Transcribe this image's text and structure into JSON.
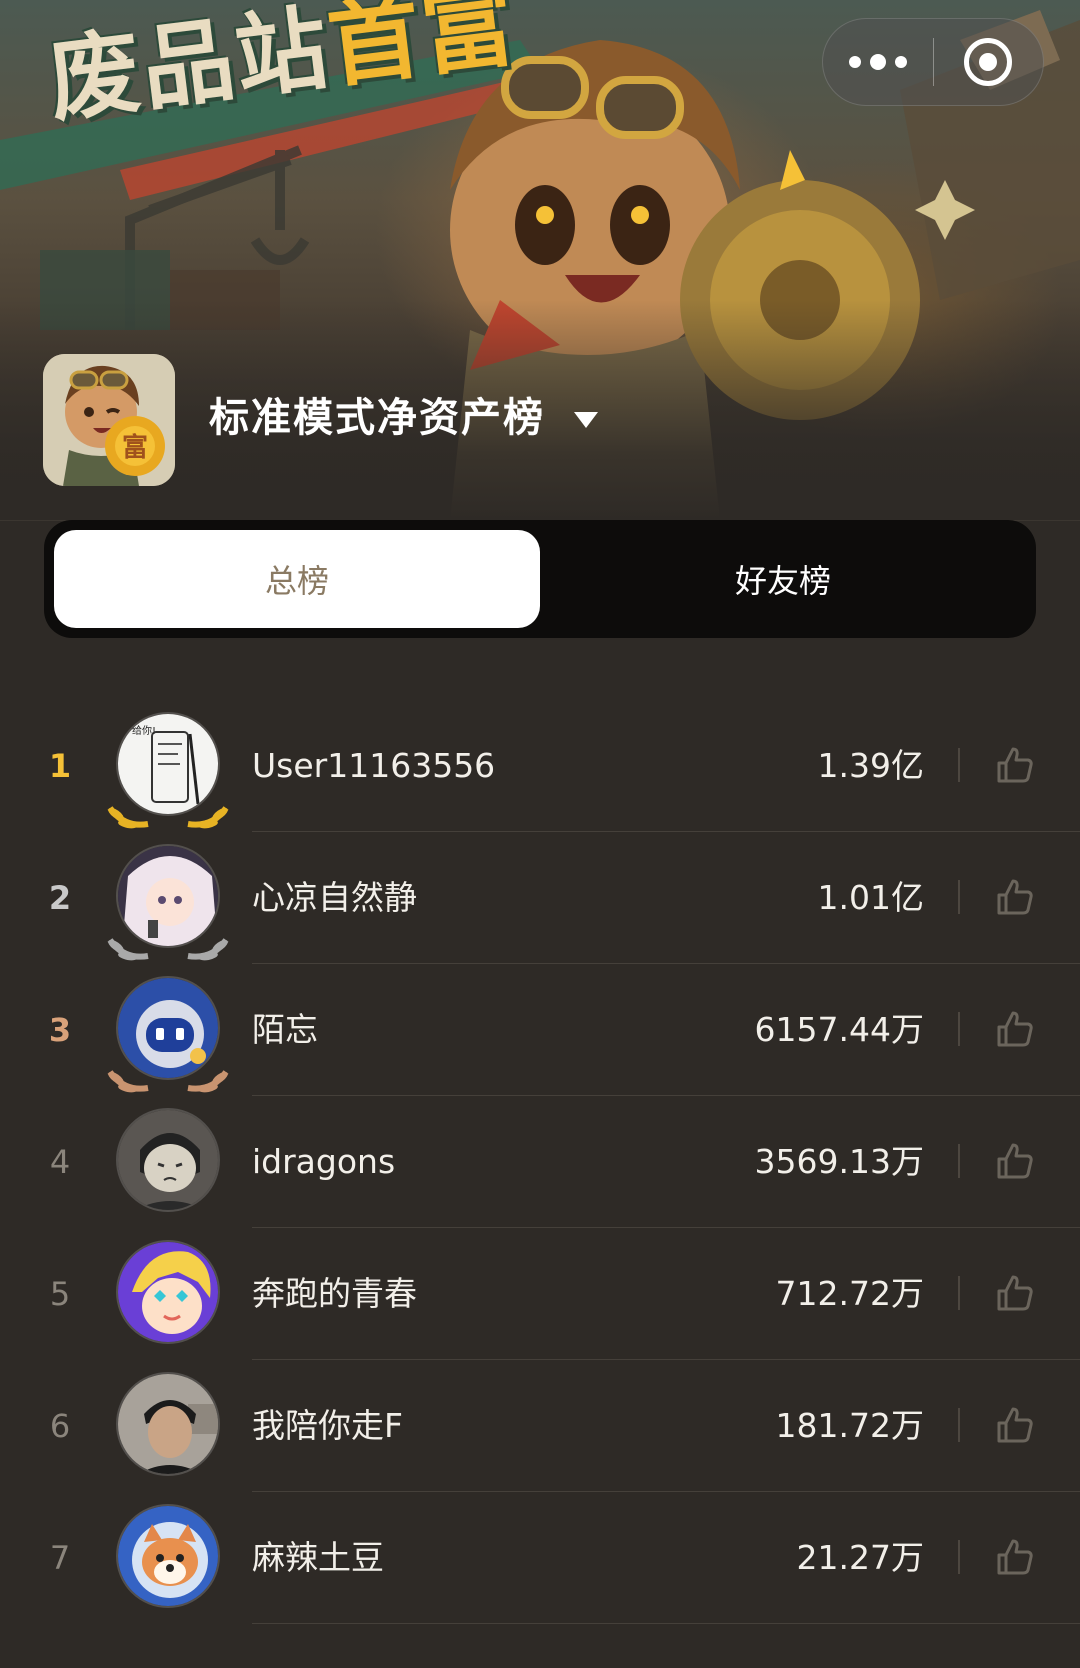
{
  "game": {
    "logo_text_main": "废品站",
    "logo_text_gold": "首富"
  },
  "capsule": {
    "more_icon": "more-dots-icon",
    "close_icon": "target-close-icon"
  },
  "board": {
    "title": "标准模式净资产榜",
    "dropdown_icon": "caret-down-icon"
  },
  "tabs": [
    {
      "label": "总榜",
      "active": true
    },
    {
      "label": "好友榜",
      "active": false
    }
  ],
  "leaderboard": [
    {
      "rank": "1",
      "name": "User11163556",
      "score": "1.39亿"
    },
    {
      "rank": "2",
      "name": "心凉自然静",
      "score": "1.01亿"
    },
    {
      "rank": "3",
      "name": "陌忘",
      "score": "6157.44万"
    },
    {
      "rank": "4",
      "name": "idragons",
      "score": "3569.13万"
    },
    {
      "rank": "5",
      "name": "奔跑的青春",
      "score": "712.72万"
    },
    {
      "rank": "6",
      "name": "我陪你走F",
      "score": "181.72万"
    },
    {
      "rank": "7",
      "name": "麻辣土豆",
      "score": "21.27万"
    }
  ],
  "colors": {
    "background": "#2e2a26",
    "gold": "#f5c137",
    "silver": "#c9c9c9",
    "bronze": "#d9a27a",
    "tab_bar": "#0d0c0b"
  }
}
